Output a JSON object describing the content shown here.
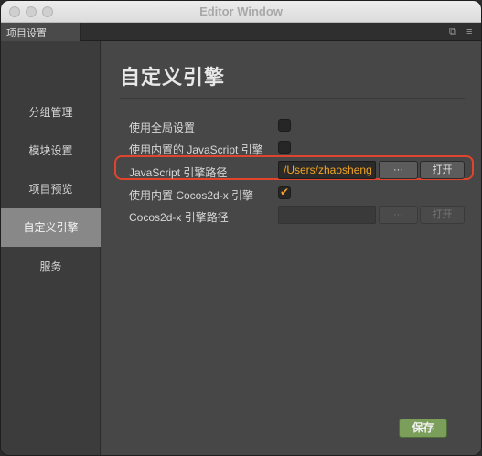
{
  "window": {
    "title": "Editor Window"
  },
  "tabbar": {
    "tab_label": "项目设置",
    "icons": [
      "popout-icon",
      "menu-icon"
    ]
  },
  "sidebar": {
    "items": [
      {
        "label": "分组管理",
        "active": false
      },
      {
        "label": "模块设置",
        "active": false
      },
      {
        "label": "项目预览",
        "active": false
      },
      {
        "label": "自定义引擎",
        "active": true
      },
      {
        "label": "服务",
        "active": false
      }
    ]
  },
  "main": {
    "title": "自定义引擎",
    "rows": [
      {
        "label": "使用全局设置",
        "checked": false
      },
      {
        "label": "使用内置的 JavaScript 引擎",
        "checked": false
      },
      {
        "label": "JavaScript 引擎路径",
        "value": "/Users/zhaosheng",
        "browse_label": "···",
        "open_label": "打开"
      },
      {
        "label": "使用内置 Cocos2d-x 引擎",
        "checked": true
      },
      {
        "label": "Cocos2d-x 引擎路径",
        "value": "",
        "browse_label": "···",
        "open_label": "打开"
      }
    ],
    "save_label": "保存"
  },
  "colors": {
    "accent_path": "#f5a623",
    "highlight": "#e0442c",
    "save": "#7b9e5a"
  }
}
